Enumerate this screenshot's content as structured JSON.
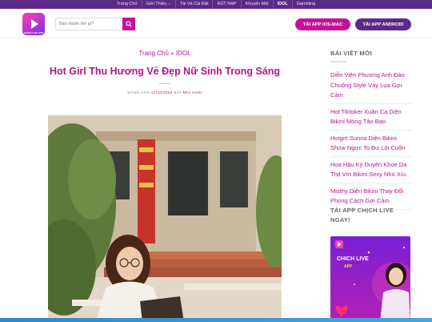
{
  "topnav": {
    "items": [
      "Trang Chủ",
      "Giới Thiệu",
      "Tải Và Cài Đặt",
      "RÚT NẠP",
      "Khuyến Mãi",
      "IDOL",
      "Gambling"
    ]
  },
  "header": {
    "logo_text": "CHICH LIVE APP",
    "search_placeholder": "Bạn muốn tìm gì?",
    "ios_button": "TẢI APP IOS-MAC",
    "android_button": "TẢI APP ANDROID"
  },
  "article": {
    "breadcrumb_home": "Trang Chủ",
    "breadcrumb_sep": "»",
    "breadcrumb_current": "IDOL",
    "title": "Hot Girl Thu Hương Vẻ Đẹp Nữ Sinh Trong Sáng",
    "meta_prefix": "ĐĂNG VÀO",
    "meta_date": "12/10/2024",
    "meta_by": "BỞI",
    "meta_author": "MIU XINH"
  },
  "sidebar": {
    "recent_heading": "BÀI VIẾT MỚI",
    "posts": [
      "Diễn Viên Phương Anh Đào Chuộng Style Váy Lụa Gợi Cảm",
      "Hot Tiktoker Xuân Ca Diện Bikini Mỏng Tảo Bạo",
      "Hotgirl Sunna Diện Bikini Show Ngực To Bự Lôi Cuốn",
      "Hoa Hậu Kỳ Duyên Khoe Da Thịt Với Bikini Sexy Nhỏ Xíu",
      "Misthy Diện Bikini Thay Đổi Phong Cách Gợi Cảm"
    ],
    "download_heading": "TẢI APP CHỊCH LIVE NGAY!",
    "promo_title": "CHICH LIVE",
    "promo_sub": "APP"
  },
  "colors": {
    "brand_purple": "#5b2a86",
    "brand_magenta": "#c4139b",
    "link": "#b3158c"
  }
}
